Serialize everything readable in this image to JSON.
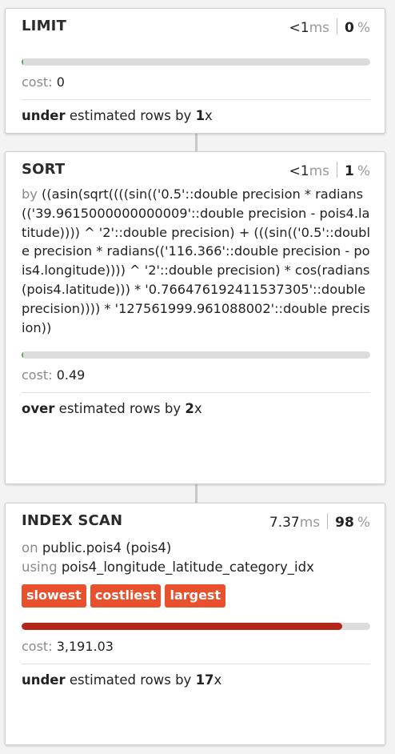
{
  "nodes": [
    {
      "title": "LIMIT",
      "time_value": "<1",
      "time_unit": "ms",
      "percent": "0",
      "percent_sign": "%",
      "bar_fraction": 0.003,
      "bar_color": "#4caf50",
      "cost_label": "cost:",
      "cost_value": "0",
      "estimate_dir": "under",
      "estimate_text": "estimated rows by",
      "estimate_factor": "1",
      "estimate_suffix": "x"
    },
    {
      "title": "SORT",
      "time_value": "<1",
      "time_unit": "ms",
      "percent": "1",
      "percent_sign": "%",
      "detail_prefix": "by",
      "detail_text": "((asin(sqrt((((sin(('0.5'::double precision * radians(('39.9615000000000009'::double precision - pois4.latitude)))) ^ '2'::double precision) + (((sin(('0.5'::double precision * radians(('116.366'::double precision - pois4.longitude)))) ^ '2'::double precision) * cos(radians(pois4.latitude))) * '0.766476192411537305'::double precision)))) * '127561999.961088002'::double precision))",
      "bar_fraction": 0.003,
      "bar_color": "#4caf50",
      "cost_label": "cost:",
      "cost_value": "0.49",
      "estimate_dir": "over",
      "estimate_text": "estimated rows by",
      "estimate_factor": "2",
      "estimate_suffix": "x"
    },
    {
      "title": "INDEX SCAN",
      "time_value": "7.37",
      "time_unit": "ms",
      "percent": "98",
      "percent_sign": "%",
      "on_label": "on",
      "on_value": "public.pois4 (pois4)",
      "using_label": "using",
      "using_value": "pois4_longitude_latitude_category_idx",
      "tags": [
        "slowest",
        "costliest",
        "largest"
      ],
      "tag_color": "#e8502e",
      "bar_fraction": 0.92,
      "bar_color": "#b5261a",
      "cost_label": "cost:",
      "cost_value": "3,191.03",
      "estimate_dir": "under",
      "estimate_text": "estimated rows by",
      "estimate_factor": "17",
      "estimate_suffix": "x"
    }
  ]
}
